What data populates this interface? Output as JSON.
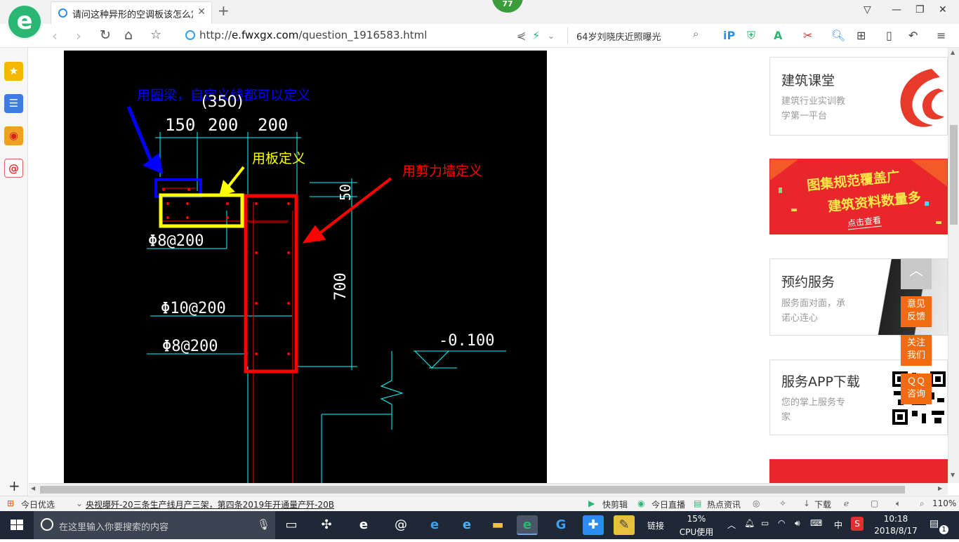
{
  "browser": {
    "tab_title": "请问这种异形的空调板该怎么定义",
    "badge_count": "77",
    "url_host": "e.fwxgx.com",
    "url_path": "/question_1916583.html",
    "url_prefix": "http://",
    "search_suggestion": "64岁刘晓庆近照曝光"
  },
  "drawing": {
    "annotation_blue": "用圈梁，自定义线都可以定义",
    "annotation_yellow": "用板定义",
    "annotation_red": "用剪力墙定义",
    "dim_350": "(350)",
    "dim_150": "150",
    "dim_200a": "200",
    "dim_200b": "200",
    "dim_50": "50",
    "dim_700": "700",
    "rebar_1": "Φ8@200",
    "rebar_2": "Φ10@200",
    "rebar_3": "Φ8@200",
    "elevation": "-0.100"
  },
  "sidebar": {
    "card1_title": "建筑课堂",
    "card1_line1": "建筑行业实训教",
    "card1_line2": "学第一平台",
    "ad_line1": "图集规范覆盖广",
    "ad_line2": "建筑资料数量多",
    "ad_link": "点击查看",
    "card3_title": "预约服务",
    "card3_line1": "服务面对面，承",
    "card3_line2": "诺心连心",
    "card4_title": "服务APP下载",
    "card4_line1": "您的掌上服务专",
    "card4_line2": "家",
    "feedback": "意见反馈",
    "follow": "关注我们",
    "qq": "ＱＱ咨询"
  },
  "statusbar": {
    "today_pick": "今日优选",
    "news": "央视曝歼-20三条生产线月产三架，第四条2019年开通量产歼-20B",
    "cut": "快剪辑",
    "live": "今日直播",
    "hot": "热点资讯",
    "download": "下载",
    "zoom": "110%"
  },
  "taskbar": {
    "search_placeholder": "在这里输入你要搜索的内容",
    "link_label": "链接",
    "cpu_percent": "15%",
    "cpu_label": "CPU使用",
    "ime": "中",
    "time": "10:18",
    "date": "2018/8/17",
    "notify_count": "1"
  },
  "colors": {
    "annotation_blue": "#0000ff",
    "annotation_yellow": "#ffff00",
    "annotation_red": "#ff0000",
    "cad_cyan": "#00ffff",
    "accent_orange": "#f26b10"
  }
}
